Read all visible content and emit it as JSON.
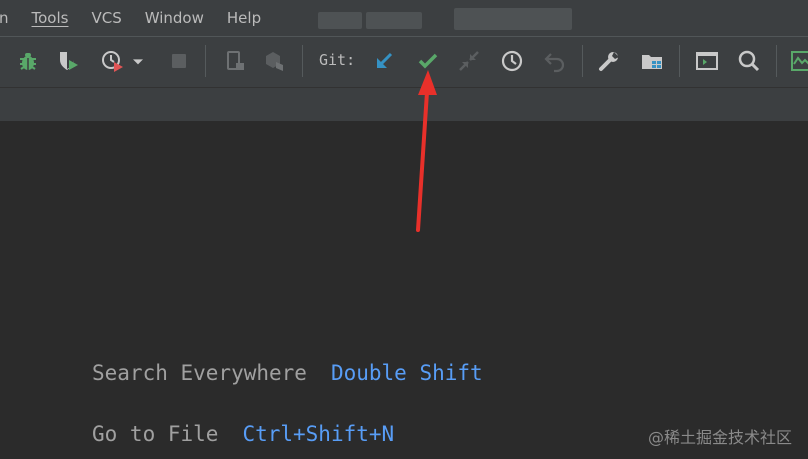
{
  "menu": {
    "items": [
      "n",
      "Tools",
      "VCS",
      "Window",
      "Help"
    ]
  },
  "toolbar": {
    "git_label": "Git:",
    "icons": {
      "debug": "bug-icon",
      "coverage": "shield-run-icon",
      "profile": "profiler-icon",
      "dropdown": "chevron-down-icon",
      "stop": "stop-icon",
      "device": "device-icon",
      "sdk": "package-icon",
      "update": "vcs-update-icon",
      "commit": "vcs-commit-icon",
      "push": "vcs-push-icon",
      "history": "history-icon",
      "rollback": "undo-icon",
      "settings": "wrench-icon",
      "project_structure": "folder-structure-icon",
      "terminal": "terminal-icon",
      "search": "search-icon",
      "monitor": "monitor-icon"
    }
  },
  "editor": {
    "hints": [
      {
        "label": "Search Everywhere",
        "shortcut": "Double Shift"
      },
      {
        "label": "Go to File",
        "shortcut": "Ctrl+Shift+N"
      }
    ]
  },
  "watermark": "@稀土掘金技术社区",
  "colors": {
    "menubar_bg": "#3c3f41",
    "editor_bg": "#2b2b2b",
    "shortcut_blue": "#589df6",
    "git_green": "#59a869",
    "update_blue": "#3592c4",
    "annotation_red": "#e8302a"
  }
}
